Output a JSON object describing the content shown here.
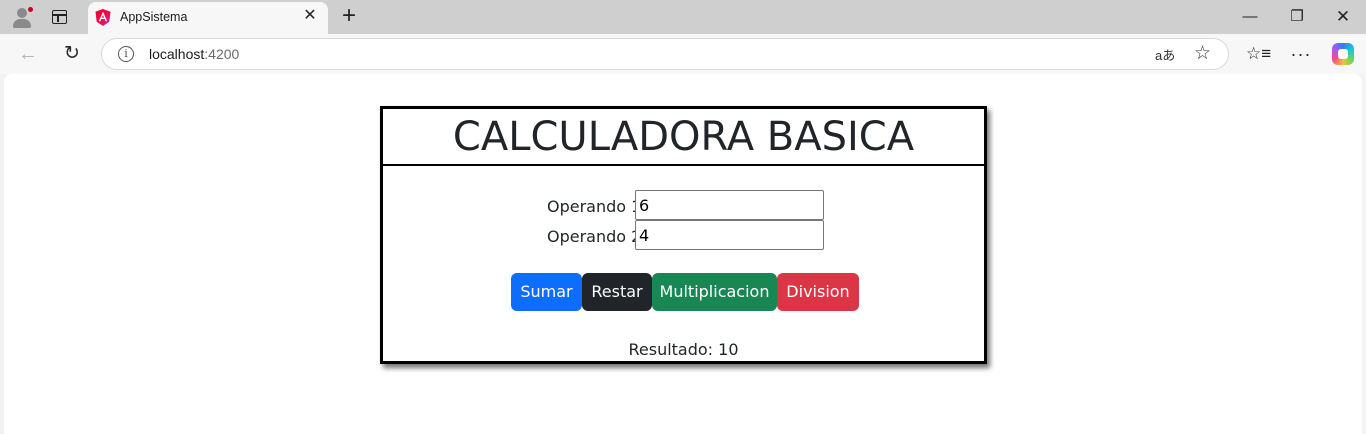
{
  "browser": {
    "tab_title": "AppSistema",
    "url_host": "localhost",
    "url_port": ":4200",
    "icons": [
      "profile-icon",
      "tab-actions-icon",
      "angular-favicon",
      "close-tab-icon",
      "new-tab-icon",
      "minimize-icon",
      "restore-icon",
      "close-window-icon",
      "back-icon",
      "reload-icon",
      "info-icon",
      "read-aloud-icon",
      "favorite-star-icon",
      "favorites-icon",
      "more-icon",
      "copilot-icon"
    ]
  },
  "calculator": {
    "title": "CALCULADORA BASICA",
    "operand1_label": "Operando 1:",
    "operand1_value": "6",
    "operand2_label": "Operando 2:",
    "operand2_value": "4",
    "buttons": {
      "add": "Sumar",
      "subtract": "Restar",
      "multiply": "Multiplicacion",
      "divide": "Division"
    },
    "result_text": "Resultado: 10"
  },
  "colors": {
    "add": "#0d6efd",
    "subtract": "#212529",
    "multiply": "#198754",
    "divide": "#dc3545"
  }
}
